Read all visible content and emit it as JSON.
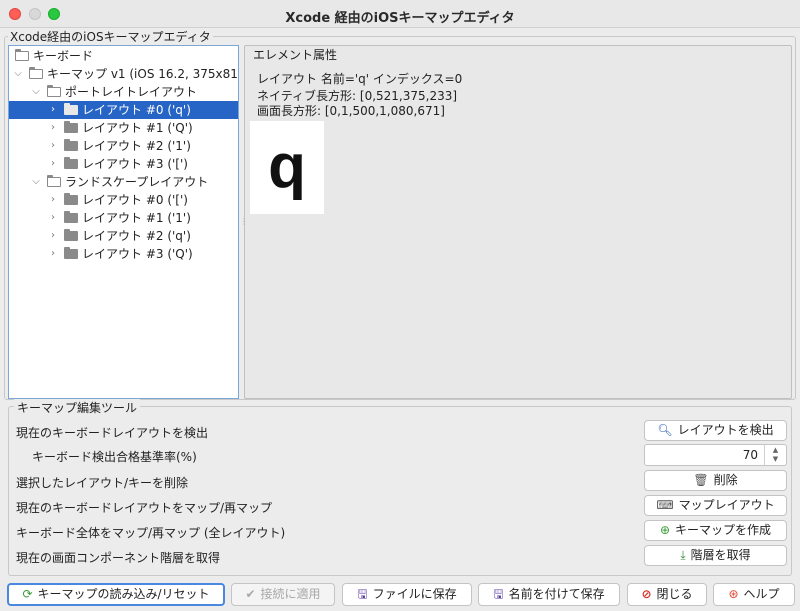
{
  "window": {
    "title": "Xcode 経由のiOSキーマップエディタ"
  },
  "main_group": {
    "legend": "Xcode経由のiOSキーマップエディタ"
  },
  "tree": {
    "root": "キーボード",
    "keymap": "キーマップ v1 (iOS 16.2, 375x812)",
    "portrait": "ポートレイトレイアウト",
    "portrait_items": [
      "レイアウト #0 ('q')",
      "レイアウト #1 ('Q')",
      "レイアウト #2 ('1')",
      "レイアウト #3 ('[')"
    ],
    "landscape": "ランドスケープレイアウト",
    "landscape_items": [
      "レイアウト #0 ('[')",
      "レイアウト #1 ('1')",
      "レイアウト #2 ('q')",
      "レイアウト #3 ('Q')"
    ]
  },
  "attributes": {
    "legend": "エレメント属性",
    "line1": "レイアウト 名前='q' インデックス=0",
    "line2": "ネイティブ長方形: [0,521,375,233]",
    "line3": "画面長方形: [0,1,500,1,080,671]",
    "key_char": "q"
  },
  "tools": {
    "legend": "キーマップ編集ツール",
    "detect_label": "現在のキーボードレイアウトを検出",
    "detect_button": "レイアウトを検出",
    "threshold_label": "キーボード検出合格基準率(%)",
    "threshold_value": "70",
    "delete_label": "選択したレイアウト/キーを削除",
    "delete_button": "削除",
    "map_label": "現在のキーボードレイアウトをマップ/再マップ",
    "map_button": "マップレイアウト",
    "map_all_label": "キーボード全体をマップ/再マップ (全レイアウト)",
    "map_all_button": "キーマップを作成",
    "hierarchy_label": "現在の画面コンポーネント階層を取得",
    "hierarchy_button": "階層を取得"
  },
  "bottom": {
    "load_reset": "キーマップの読み込み/リセット",
    "apply": "接続に適用",
    "save_file": "ファイルに保存",
    "save_as": "名前を付けて保存",
    "close": "閉じる",
    "help": "ヘルプ"
  },
  "colors": {
    "selection": "#2664c6",
    "focus_border": "#4a87e0",
    "close_icon": "#d93025",
    "help_icon": "#e0442e"
  }
}
